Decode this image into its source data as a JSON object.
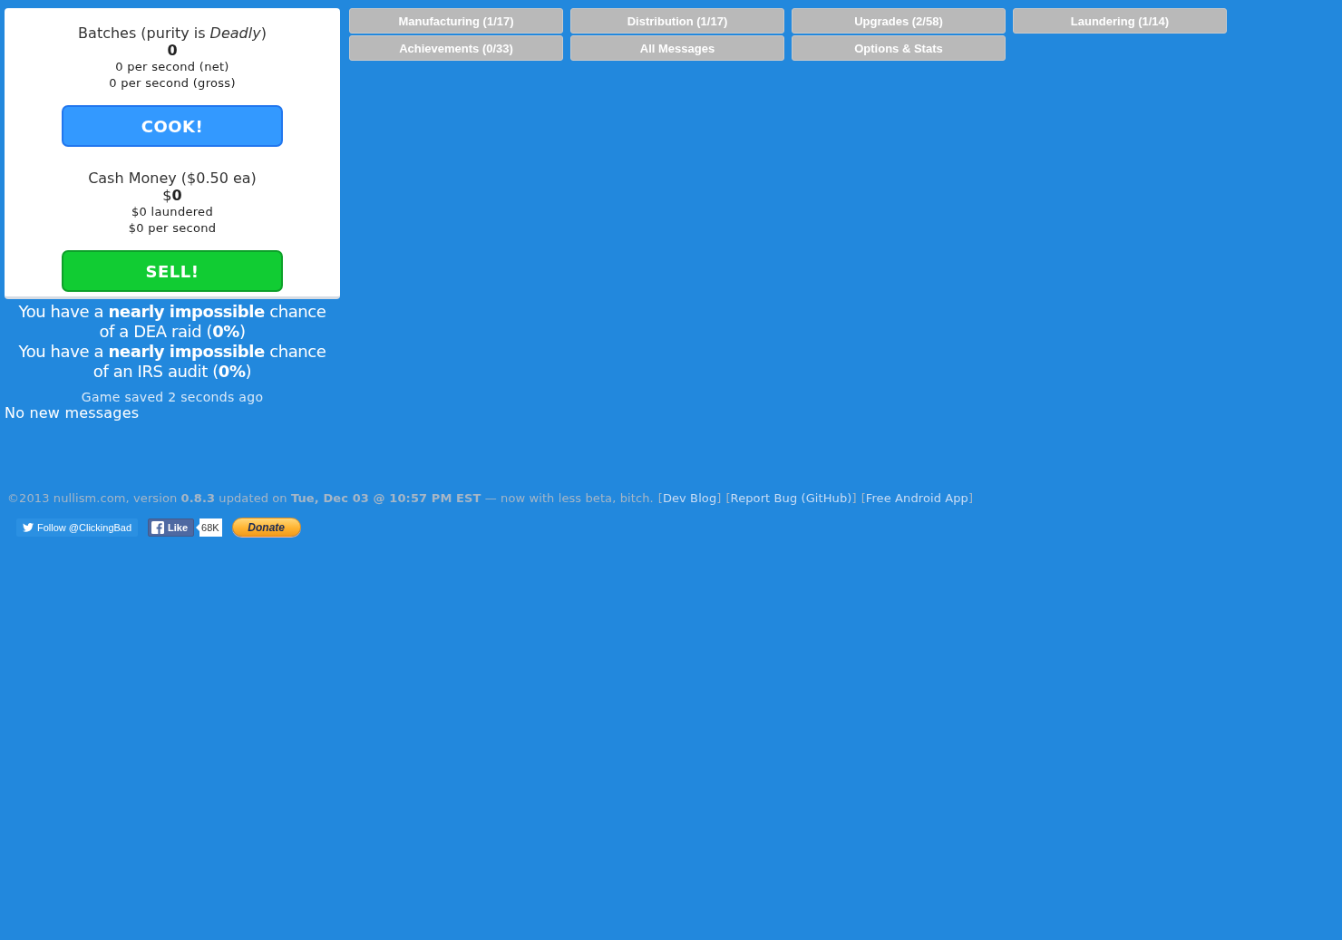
{
  "batches": {
    "title": "Batches (purity is *Deadly*)",
    "count": "0",
    "rates": [
      "0 per second (net)",
      "0 per second (gross)"
    ],
    "button": "COOK!"
  },
  "cash": {
    "title": "Cash Money ($0.50 ea)",
    "amount": "$**0**",
    "details": [
      "$0 laundered",
      "$0 per second"
    ],
    "button": "SELL!"
  },
  "risks": [
    "You have a **nearly impossible** chance of a DEA raid (**0%**)",
    "You have a **nearly impossible** chance of an IRS audit (**0%**)"
  ],
  "save_status": "Game saved 2 seconds ago",
  "messages": "No new messages",
  "tabs": [
    {
      "label": "Manufacturing (1/17)"
    },
    {
      "label": "Distribution (1/17)"
    },
    {
      "label": "Upgrades (2/58)"
    },
    {
      "label": "Laundering (1/14)"
    },
    {
      "label": "Achievements (0/33)"
    },
    {
      "label": "All Messages"
    },
    {
      "label": "Options & Stats"
    }
  ],
  "footer": {
    "text": "©2013 nullism.com, version **0.8.3** updated on **Tue, Dec 03 @ 10:57 PM EST** — now with less beta, bitch.",
    "links": [
      "[Dev Blog]",
      "[Report Bug (GitHub)]",
      "[Free Android App]"
    ]
  },
  "social": {
    "follow": "Follow @ClickingBad",
    "like": "Like",
    "like_count": "68K",
    "donate": "Donate"
  }
}
